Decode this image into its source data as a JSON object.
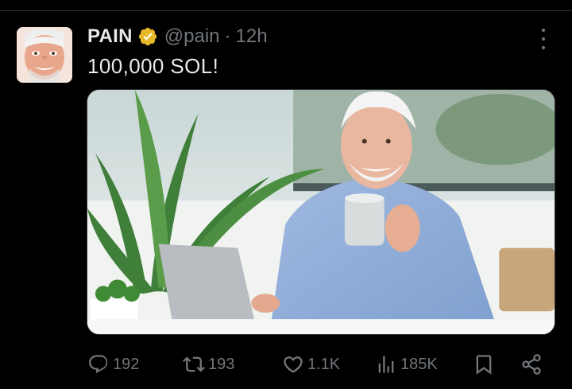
{
  "tweet": {
    "display_name": "PAIN",
    "verified_badge": "verified-badge-gold",
    "handle": "@pain",
    "separator": "·",
    "time": "12h",
    "text": "100,000 SOL!",
    "media": {
      "description_icon": "photo"
    }
  },
  "actions": {
    "replies": "192",
    "retweets": "193",
    "likes": "1.1K",
    "views": "185K"
  },
  "colors": {
    "background": "#000000",
    "text_primary": "#e7e9ea",
    "text_secondary": "#71767b",
    "verified_gold": "#e8b829",
    "divider": "#2f3336"
  }
}
